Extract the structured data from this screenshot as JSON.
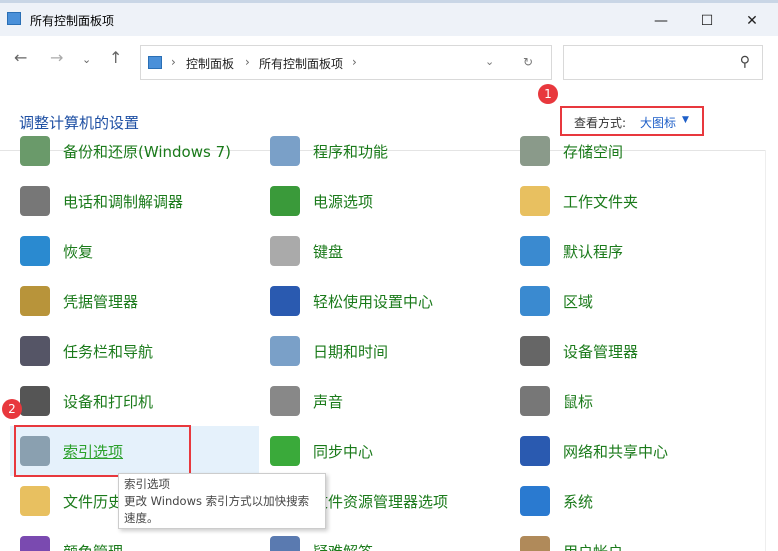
{
  "window": {
    "title": "所有控制面板项"
  },
  "address": {
    "crumbs": [
      "控制面板",
      "所有控制面板项"
    ]
  },
  "search": {
    "placeholder": ""
  },
  "header": {
    "title": "调整计算机的设置",
    "view_label": "查看方式:",
    "view_value": "大图标"
  },
  "badges": [
    "1",
    "2"
  ],
  "items": [
    {
      "label": "备份和还原(Windows 7)",
      "color": "#6a9a6a"
    },
    {
      "label": "程序和功能",
      "color": "#7aa0c8"
    },
    {
      "label": "存储空间",
      "color": "#8a9a8a"
    },
    {
      "label": "电话和调制解调器",
      "color": "#777"
    },
    {
      "label": "电源选项",
      "color": "#3a9a3a"
    },
    {
      "label": "工作文件夹",
      "color": "#e8c060"
    },
    {
      "label": "恢复",
      "color": "#2a8ad0"
    },
    {
      "label": "键盘",
      "color": "#aaa"
    },
    {
      "label": "默认程序",
      "color": "#3a8ad0"
    },
    {
      "label": "凭据管理器",
      "color": "#b8943a"
    },
    {
      "label": "轻松使用设置中心",
      "color": "#2a5ab0"
    },
    {
      "label": "区域",
      "color": "#3a8ad0"
    },
    {
      "label": "任务栏和导航",
      "color": "#556"
    },
    {
      "label": "日期和时间",
      "color": "#7aa0c8"
    },
    {
      "label": "设备管理器",
      "color": "#666"
    },
    {
      "label": "设备和打印机",
      "color": "#555"
    },
    {
      "label": "声音",
      "color": "#888"
    },
    {
      "label": "鼠标",
      "color": "#777"
    },
    {
      "label": "索引选项",
      "color": "#8aa0b0"
    },
    {
      "label": "同步中心",
      "color": "#3aaa3a"
    },
    {
      "label": "网络和共享中心",
      "color": "#2a5ab0"
    },
    {
      "label": "文件历史记录",
      "color": "#e8c060"
    },
    {
      "label": "文件资源管理器选项",
      "color": "#e8c060"
    },
    {
      "label": "系统",
      "color": "#2a7ad0"
    },
    {
      "label": "颜色管理",
      "color": "#7a4ab0"
    },
    {
      "label": "疑难解答",
      "color": "#5a7ab0"
    },
    {
      "label": "用户帐户",
      "color": "#b08a5a"
    }
  ],
  "tooltip": {
    "title": "索引选项",
    "line1": "更改 Windows 索引方式以加快搜索",
    "line2": "速度。"
  }
}
